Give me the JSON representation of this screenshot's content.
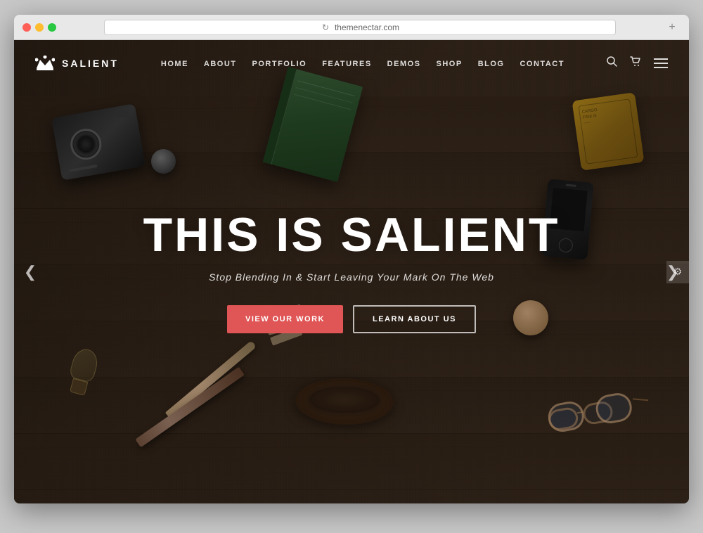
{
  "browser": {
    "url": "themenectar.com",
    "refresh_icon": "↻",
    "plus_icon": "+"
  },
  "nav": {
    "logo_text": "SALIENT",
    "menu_items": [
      {
        "label": "HOME",
        "id": "home"
      },
      {
        "label": "ABOUT",
        "id": "about"
      },
      {
        "label": "PORTFOLIO",
        "id": "portfolio"
      },
      {
        "label": "FEATURES",
        "id": "features"
      },
      {
        "label": "DEMOS",
        "id": "demos"
      },
      {
        "label": "SHOP",
        "id": "shop"
      },
      {
        "label": "BLOG",
        "id": "blog"
      },
      {
        "label": "CONTACT",
        "id": "contact"
      }
    ]
  },
  "hero": {
    "title": "THIS IS SALIENT",
    "subtitle": "Stop Blending In & Start Leaving Your Mark On The Web",
    "btn_primary": "VIEW OUR WORK",
    "btn_secondary": "LEARN ABOUT US"
  },
  "arrows": {
    "left": "❮",
    "right": "❯"
  },
  "settings_icon": "⚙"
}
